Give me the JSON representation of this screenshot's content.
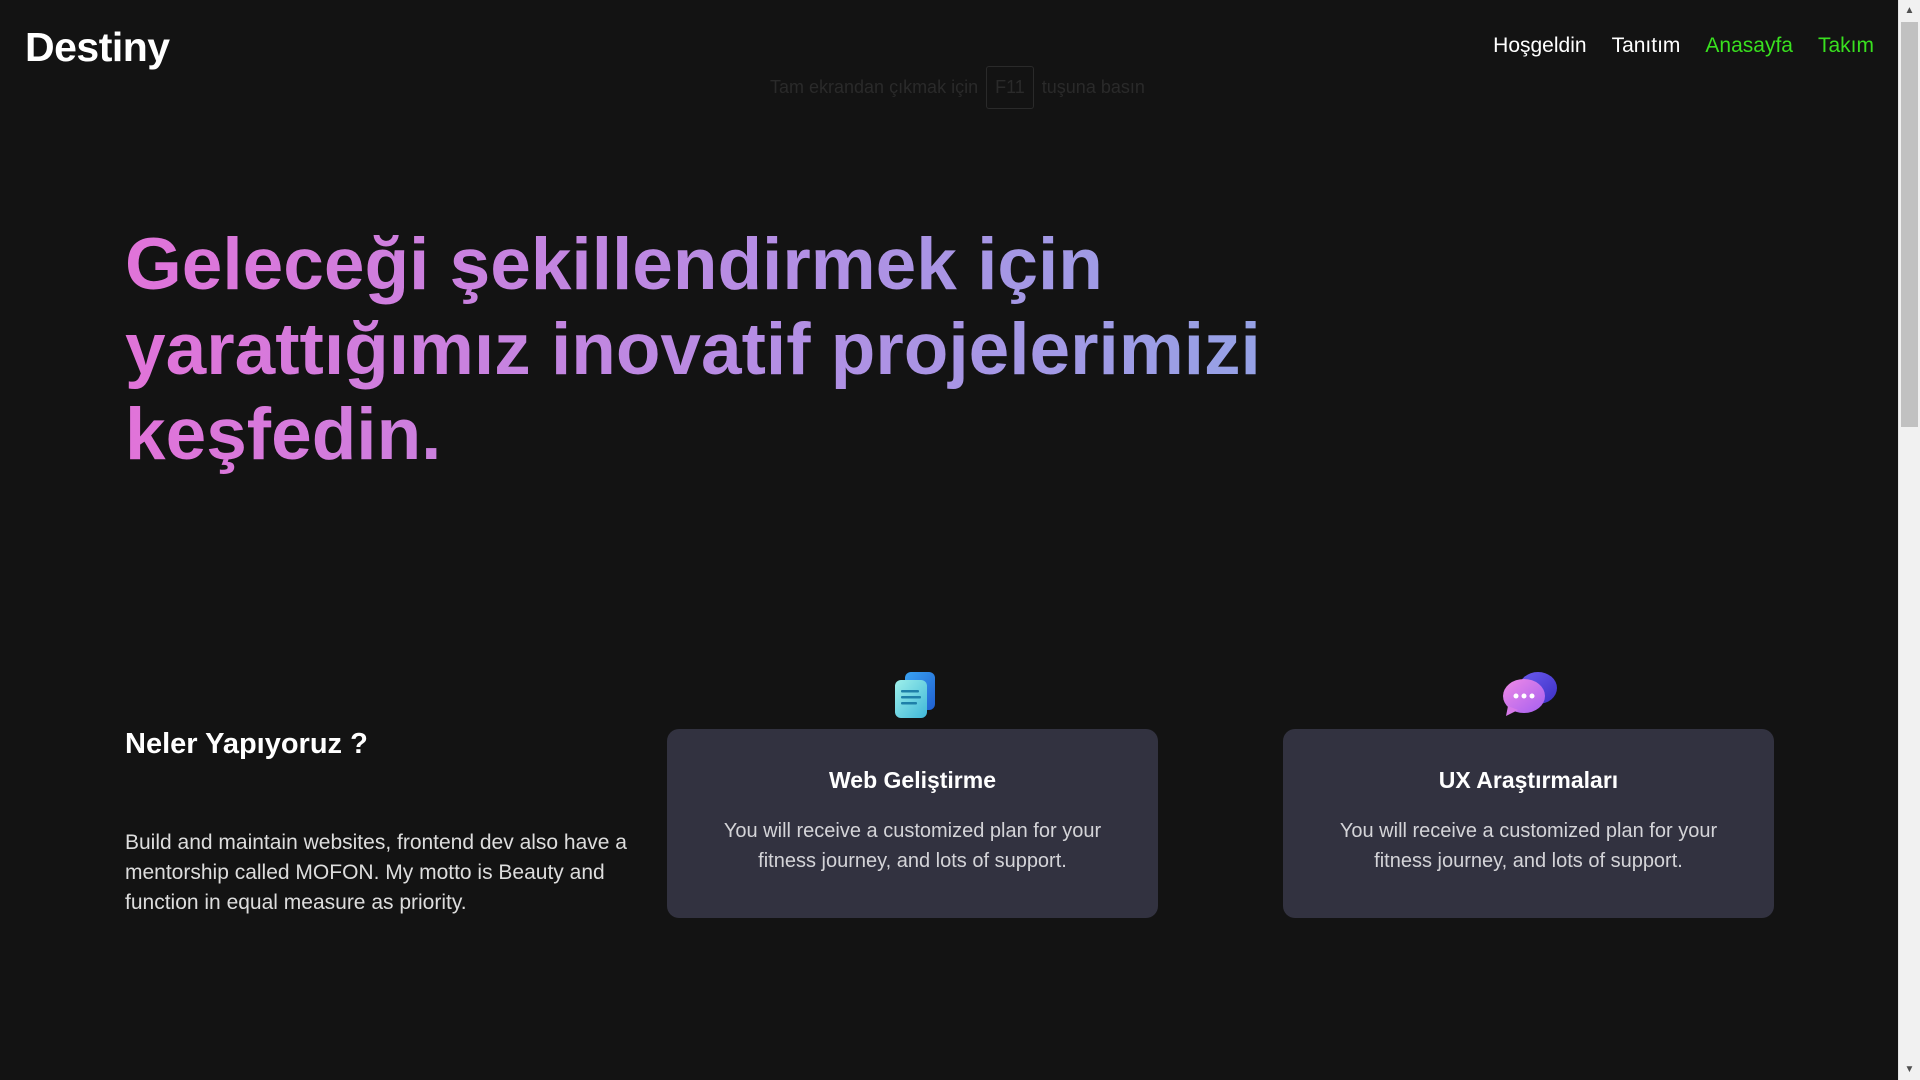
{
  "header": {
    "logo": "Destiny",
    "nav": [
      {
        "label": "Hoşgeldin"
      },
      {
        "label": "Tanıtım"
      },
      {
        "label": "Anasayfa"
      },
      {
        "label": "Takım"
      }
    ]
  },
  "fullscreen_hint": {
    "before": "Tam ekrandan çıkmak için",
    "key": "F11",
    "after": "tuşuna basın"
  },
  "hero": {
    "line1": "Geleceği şekillendirmek için",
    "line2": "yarattığımız inovatif projelerimizi",
    "line3": "keşfedin."
  },
  "services": {
    "title": "Neler Yapıyoruz ?",
    "description": "Build and maintain websites, frontend dev also have a mentorship called MOFON. My motto is Beauty and function in equal measure as priority.",
    "cards": [
      {
        "icon": "document-icon",
        "title": "Web Geliştirme",
        "text": "You will receive a customized plan for your fitness journey, and lots of support."
      },
      {
        "icon": "chat-bubbles-icon",
        "title": "UX Araştırmaları",
        "text": "You will receive a customized plan for your fitness journey, and lots of support."
      }
    ]
  },
  "colors": {
    "background": "#131313",
    "nav_active": "#39e01f",
    "card_background": "#323240",
    "gradient_start": "#e173d9",
    "gradient_end": "#8ba8e6"
  }
}
